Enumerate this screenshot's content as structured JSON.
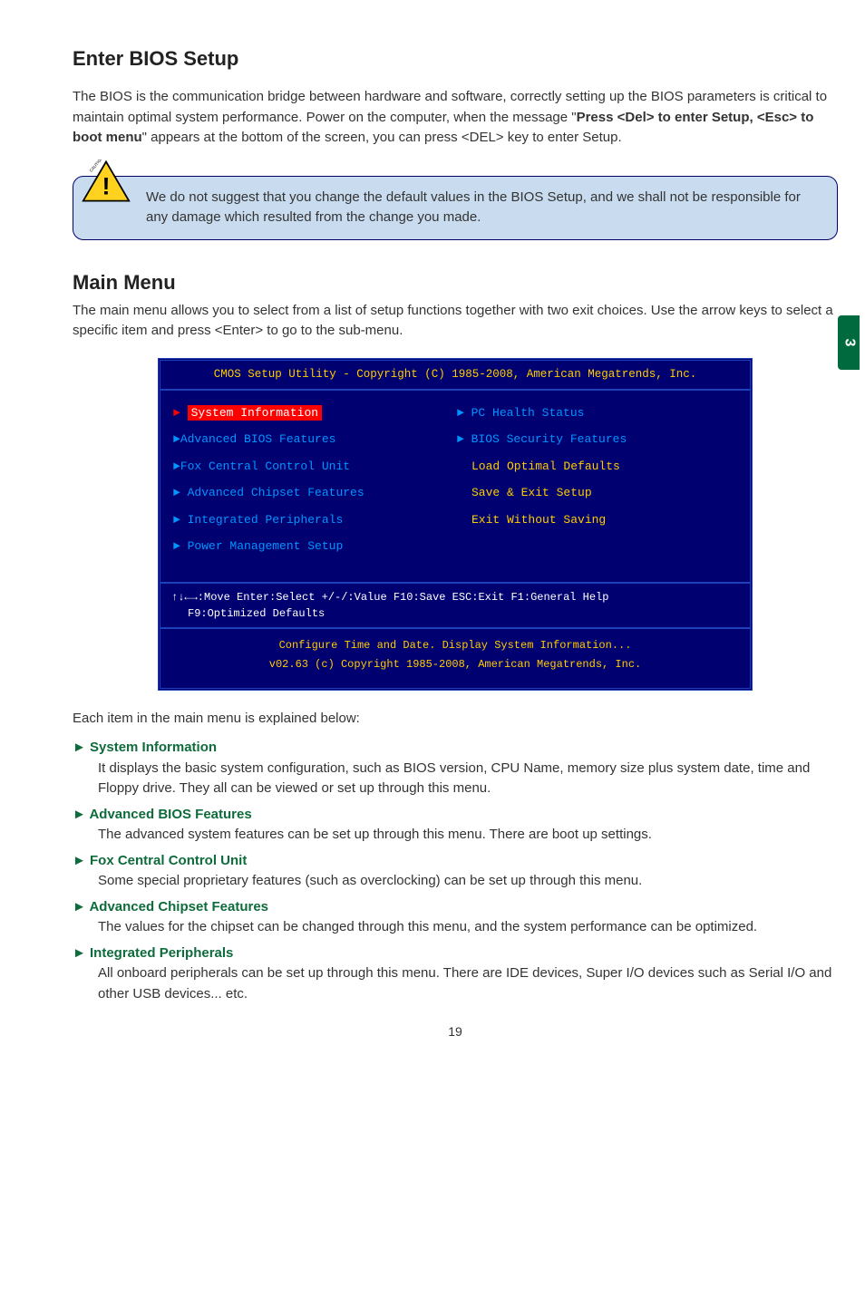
{
  "section1": {
    "title": "Enter BIOS Setup",
    "para_pre": "The BIOS is the communication bridge between hardware and software, correctly setting up the BIOS parameters is critical to maintain optimal system performance. Power on the computer, when the message \"",
    "para_bold": "Press <Del> to enter Setup, <Esc> to boot menu",
    "para_post": "\" appears at the bottom of the screen, you can press <DEL> key to enter Setup."
  },
  "caution": {
    "icon_label": "CAUTION",
    "text": "We do not suggest that you change the default values in the BIOS Setup, and we shall not be responsible for any damage which resulted from the change you made."
  },
  "page_tab": "3",
  "section2": {
    "title": "Main Menu",
    "para": "The main menu allows you to select from a list of setup functions together with two exit choices. Use the arrow keys to select a specific item and press <Enter> to go to the sub-menu."
  },
  "bios": {
    "title": "CMOS Setup Utility - Copyright (C) 1985-2008, American Megatrends, Inc.",
    "left_items": [
      {
        "arrow": "►",
        "arrow_color": "red",
        "label": "System Information",
        "selected": true,
        "color": "white"
      },
      {
        "arrow": "►",
        "arrow_color": "blue",
        "label": "Advanced BIOS Features",
        "color": "blue"
      },
      {
        "arrow": "►",
        "arrow_color": "blue",
        "label": "Fox Central Control Unit",
        "color": "blue"
      },
      {
        "arrow": "►",
        "arrow_color": "blue",
        "label": "Advanced Chipset Features",
        "color": "blue"
      },
      {
        "arrow": "►",
        "arrow_color": "blue",
        "label": "Integrated Peripherals",
        "color": "blue"
      },
      {
        "arrow": "►",
        "arrow_color": "blue",
        "label": "Power Management Setup",
        "color": "blue"
      }
    ],
    "right_items": [
      {
        "arrow": "►",
        "arrow_color": "blue",
        "label": "PC Health Status",
        "color": "blue"
      },
      {
        "arrow": "►",
        "arrow_color": "blue",
        "label": "BIOS Security Features",
        "color": "blue"
      },
      {
        "arrow": "",
        "arrow_color": "",
        "label": "Load Optimal Defaults",
        "color": "yellow",
        "indent": true
      },
      {
        "arrow": "",
        "arrow_color": "",
        "label": "Save & Exit Setup",
        "color": "yellow",
        "indent": true
      },
      {
        "arrow": "",
        "arrow_color": "",
        "label": "Exit Without Saving",
        "color": "yellow",
        "indent": true
      }
    ],
    "cmd_line1": "↑↓←→:Move  Enter:Select    +/-/:Value    F10:Save   ESC:Exit      F1:General Help",
    "cmd_line2": "F9:Optimized Defaults",
    "footer1": "Configure Time and Date.  Display System Information...",
    "footer2": "v02.63   (c) Copyright 1985-2008, American Megatrends, Inc."
  },
  "explanations": {
    "intro": "Each item in the main menu is explained below:",
    "items": [
      {
        "head": "► System Information",
        "body": "It displays the basic system configuration, such as BIOS version, CPU Name, memory size plus system date, time and Floppy drive. They all can be viewed or set up through this menu."
      },
      {
        "head": "► Advanced BIOS Features",
        "body": "The advanced system features can be set up through this menu. There are boot up settings."
      },
      {
        "head": "► Fox Central Control Unit",
        "body": "Some special proprietary features (such as overclocking) can be set up through this menu."
      },
      {
        "head": "► Advanced Chipset Features",
        "body": "The values for the chipset can be changed through this menu, and the system performance can be optimized."
      },
      {
        "head": "► Integrated Peripherals",
        "body": "All onboard peripherals can be set up through this menu. There are IDE devices, Super I/O devices such as Serial I/O and other USB devices... etc."
      }
    ]
  },
  "page_number": "19"
}
